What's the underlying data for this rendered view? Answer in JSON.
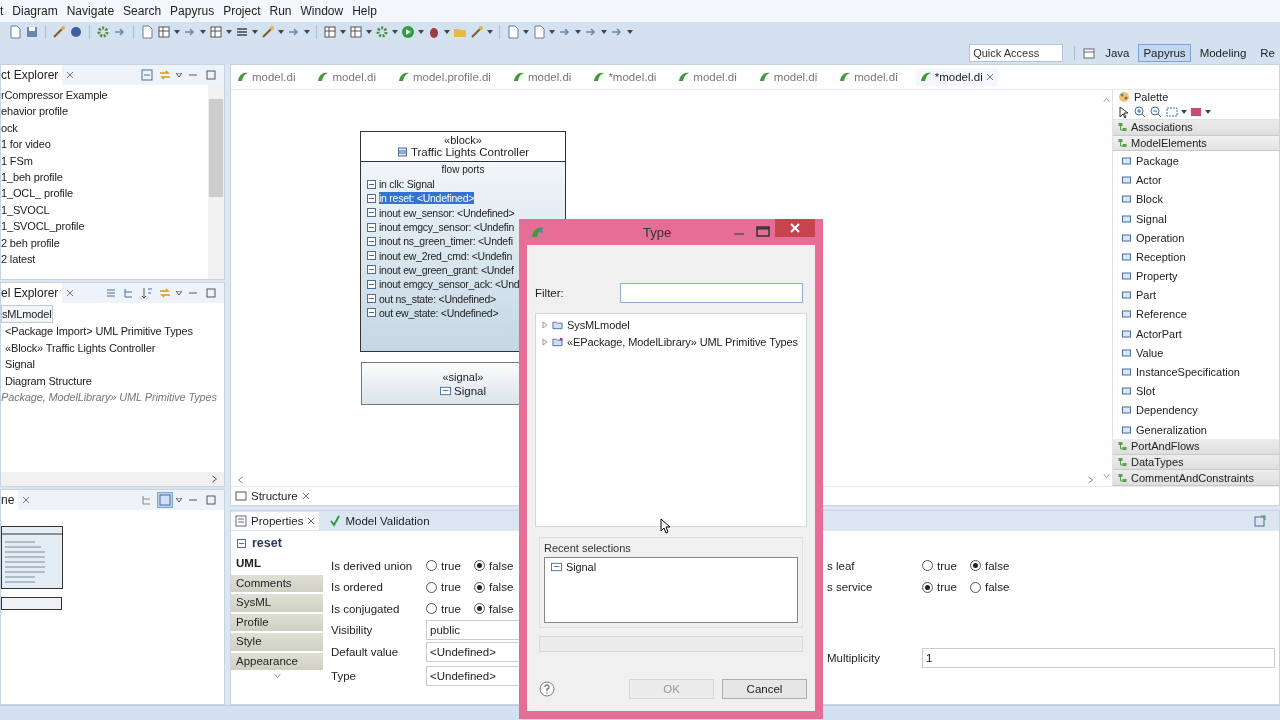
{
  "menu": [
    "t",
    "Diagram",
    "Navigate",
    "Search",
    "Papyrus",
    "Project",
    "Run",
    "Window",
    "Help"
  ],
  "quick_access": {
    "placeholder": "Quick Access"
  },
  "perspectives": [
    {
      "label": "Java",
      "selected": false
    },
    {
      "label": "Papyrus",
      "selected": true
    },
    {
      "label": "Modeling",
      "selected": false
    },
    {
      "label": "Re",
      "selected": false
    }
  ],
  "project_explorer": {
    "title": "ct Explorer",
    "items": [
      "rCompressor Example",
      "ehavior profile",
      "ock",
      "1 for video",
      "1 FSm",
      "1_beh profile",
      "1_OCL_ profile",
      "1_SVOCL",
      "1_SVOCL_profile",
      "2 beh profile",
      "2 latest"
    ]
  },
  "model_explorer": {
    "title": "el Explorer",
    "items": [
      {
        "label": "sMLmodel",
        "kind": "model",
        "selected": true,
        "children": [
          {
            "label": "<Package Import> UML Primitive Types",
            "selected": false
          },
          {
            "label": "«Block» Traffic Lights Controller",
            "selected": false
          },
          {
            "label": "Signal",
            "selected": false
          },
          {
            "label": "Diagram Structure",
            "selected": false
          }
        ]
      },
      {
        "label": "Package, ModelLibrary» UML Primitive Types",
        "kind": "library",
        "selected": false
      }
    ]
  },
  "outline": {
    "title": "ne"
  },
  "editor_tabs": [
    {
      "label": "model.di",
      "selected": false
    },
    {
      "label": "model.di",
      "selected": false
    },
    {
      "label": "model.profile.di",
      "selected": false
    },
    {
      "label": "model.di",
      "selected": false
    },
    {
      "label": "*model.di",
      "selected": false
    },
    {
      "label": "model.di",
      "selected": false
    },
    {
      "label": "model.di",
      "selected": false
    },
    {
      "label": "model.di",
      "selected": false
    },
    {
      "label": "*model.di",
      "selected": true
    }
  ],
  "block": {
    "stereotype": "«block»",
    "name": "Traffic Lights Controller",
    "compartment": "flow ports",
    "ports": [
      {
        "label": "in clk: Signal",
        "selected": false
      },
      {
        "label": "in reset: <Undefined>",
        "selected": true
      },
      {
        "label": "inout ew_sensor: <Undefined>",
        "selected": false
      },
      {
        "label": "inout emgcy_sensor: <Undefin",
        "selected": false
      },
      {
        "label": "inout ns_green_timer: <Undefi",
        "selected": false
      },
      {
        "label": "inout ew_2red_cmd: <Undefin",
        "selected": false
      },
      {
        "label": "inout ew_green_grant: <Undef",
        "selected": false
      },
      {
        "label": "inout emgcy_sensor_ack: <Und",
        "selected": false
      },
      {
        "label": "out ns_state: <Undefined>",
        "selected": false
      },
      {
        "label": "out ew_state: <Undefined>",
        "selected": false
      }
    ]
  },
  "signal": {
    "stereotype": "«signal»",
    "name": "Signal"
  },
  "palette": {
    "title": "Palette",
    "drawers": [
      {
        "label": "Associations",
        "expanded": false
      },
      {
        "label": "ModelElements",
        "expanded": true,
        "items": [
          "Package",
          "Actor",
          "Block",
          "Signal",
          "Operation",
          "Reception",
          "Property",
          "Part",
          "Reference",
          "ActorPart",
          "Value",
          "InstanceSpecification",
          "Slot",
          "Dependency",
          "Generalization"
        ]
      },
      {
        "label": "PortAndFlows",
        "expanded": false
      },
      {
        "label": "DataTypes",
        "expanded": false
      },
      {
        "label": "CommentAndConstraints",
        "expanded": false
      }
    ]
  },
  "structure_tab": "Structure",
  "properties": {
    "tabs": [
      {
        "label": "Properties",
        "selected": true
      },
      {
        "label": "Model Validation",
        "selected": false
      }
    ],
    "element": "reset",
    "sections": [
      {
        "label": "UML",
        "selected": true
      },
      {
        "label": "Comments",
        "selected": false
      },
      {
        "label": "SysML",
        "selected": false
      },
      {
        "label": "Profile",
        "selected": false
      },
      {
        "label": "Style",
        "selected": false
      },
      {
        "label": "Appearance",
        "selected": false
      }
    ],
    "fields": [
      {
        "kind": "radio",
        "label": "Is derived union",
        "options": [
          {
            "label": "true",
            "selected": false
          },
          {
            "label": "false",
            "selected": true
          }
        ]
      },
      {
        "kind": "radio",
        "label": "Is ordered",
        "options": [
          {
            "label": "true",
            "selected": false
          },
          {
            "label": "false",
            "selected": true
          }
        ]
      },
      {
        "kind": "radio",
        "label": "Is conjugated",
        "options": [
          {
            "label": "true",
            "selected": false
          },
          {
            "label": "false",
            "selected": true
          }
        ]
      },
      {
        "kind": "combo",
        "label": "Visibility",
        "value": "public"
      },
      {
        "kind": "text",
        "label": "Default value",
        "value": "<Undefined>"
      },
      {
        "kind": "text",
        "label": "Type",
        "value": "<Undefined>"
      }
    ],
    "fields_right": [
      {
        "kind": "radio",
        "label": "s leaf",
        "options": [
          {
            "label": "true",
            "selected": false
          },
          {
            "label": "false",
            "selected": true
          }
        ]
      },
      {
        "kind": "radio",
        "label": "s service",
        "options": [
          {
            "label": "true",
            "selected": true
          },
          {
            "label": "false",
            "selected": false
          }
        ]
      },
      {
        "kind": "spacer"
      },
      {
        "kind": "spacer"
      },
      {
        "kind": "text",
        "label": "Multiplicity",
        "value": "1"
      }
    ]
  },
  "dialog": {
    "title": "Type",
    "filter_label": "Filter:",
    "tree": [
      {
        "label": "SysMLmodel",
        "kind": "folder",
        "expanded": false
      },
      {
        "label": "«EPackage, ModelLibrary» UML Primitive Types",
        "kind": "library",
        "expanded": false
      }
    ],
    "recent_label": "Recent selections",
    "recent": [
      "Signal"
    ],
    "buttons": [
      {
        "label": "OK",
        "disabled": true
      },
      {
        "label": "Cancel",
        "disabled": false
      }
    ]
  }
}
